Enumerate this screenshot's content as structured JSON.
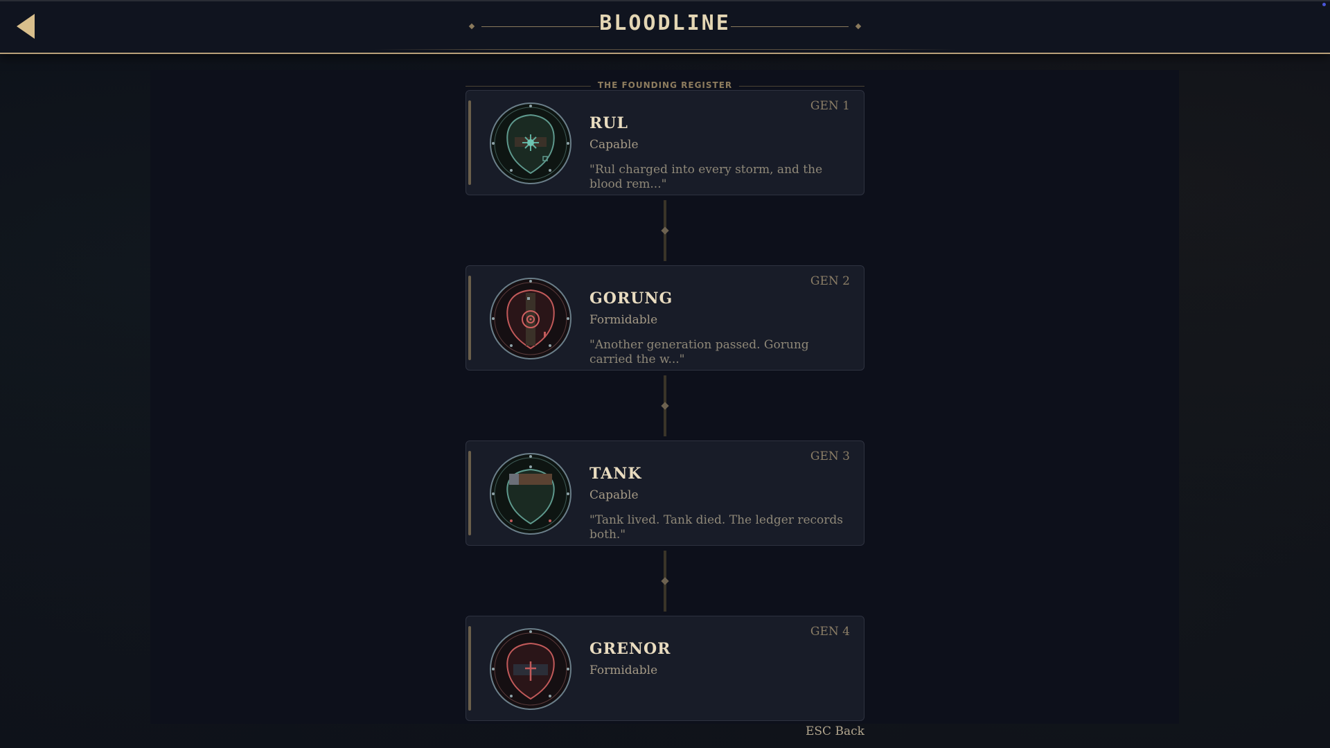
{
  "header": {
    "title": "BLOODLINE",
    "back_icon": "back-arrow-icon"
  },
  "register": {
    "label": "THE FOUNDING REGISTER"
  },
  "members": [
    {
      "gen": "GEN 1",
      "name": "RUL",
      "trait": "Capable",
      "quote": "\"Rul charged into every storm, and the blood rem...\"",
      "crest_icon": "sun-crest-icon",
      "crest_color": "#5fb0a0"
    },
    {
      "gen": "GEN 2",
      "name": "GORUNG",
      "trait": "Formidable",
      "quote": "\"Another generation passed. Gorung carried the w...\"",
      "crest_icon": "target-crest-icon",
      "crest_color": "#c25a5a"
    },
    {
      "gen": "GEN 3",
      "name": "TANK",
      "trait": "Capable",
      "quote": "\"Tank lived. Tank died. The ledger records both.\"",
      "crest_icon": "banner-crest-icon",
      "crest_color": "#5fb0a0"
    },
    {
      "gen": "GEN 4",
      "name": "GRENOR",
      "trait": "Formidable",
      "quote": "",
      "crest_icon": "cross-crest-icon",
      "crest_color": "#c25a5a"
    }
  ],
  "footer": {
    "esc_hint": "ESC Back"
  },
  "colors": {
    "accent_gold": "#b9a17a",
    "background": "#0b0e17",
    "card": "#181c28"
  }
}
